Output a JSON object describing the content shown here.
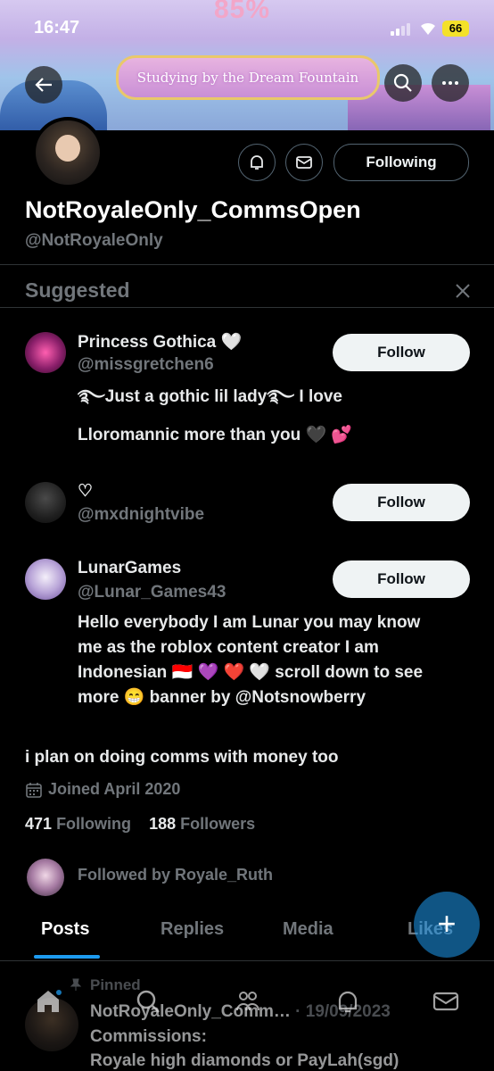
{
  "status_bar": {
    "time": "16:47",
    "battery": "66"
  },
  "banner": {
    "overlay_percent": "85%",
    "ribbon_text": "Studying by the Dream Fountain"
  },
  "header": {
    "following_label": "Following"
  },
  "profile": {
    "display_name": "NotRoyaleOnly_CommsOpen",
    "handle": "@NotRoyaleOnly",
    "bio": "i plan on doing comms with money too",
    "joined": "Joined April 2020",
    "following_count": "471",
    "following_label": "Following",
    "followers_count": "188",
    "followers_label": "Followers",
    "followed_by": "Followed by Royale_Ruth"
  },
  "suggested": {
    "title": "Suggested",
    "follow_label": "Follow",
    "accounts": [
      {
        "name": "Princess Gothica 🤍",
        "handle": "@missgretchen6",
        "bio_line1": "࿐Just a gothic lil lady࿐ I love",
        "bio_line2": "Lloromannic more than you 🖤 💕"
      },
      {
        "name": "♡",
        "handle": "@mxdnightvibe"
      },
      {
        "name": "LunarGames",
        "handle": "@Lunar_Games43",
        "bio_line1": "Hello everybody I am Lunar you may know",
        "bio_line2": "me as the roblox content creator I am",
        "bio_line3": "Indonesian 🇮🇩 💜 ❤️ 🤍 scroll down to see",
        "bio_line4": "more 😁 banner by @Notsnowberry"
      }
    ]
  },
  "tabs": [
    "Posts",
    "Replies",
    "Media",
    "Likes"
  ],
  "pinned_post": {
    "pinned_label": "Pinned",
    "author": "NotRoyaleOnly_Comm…",
    "date": "· 19/09/2023",
    "line1": "Commissions:",
    "line2": "Royale high diamonds or PayLah(sgd)"
  },
  "colors": {
    "accent": "#1d9bf0",
    "background": "#000000",
    "secondary_text": "#71767b"
  }
}
